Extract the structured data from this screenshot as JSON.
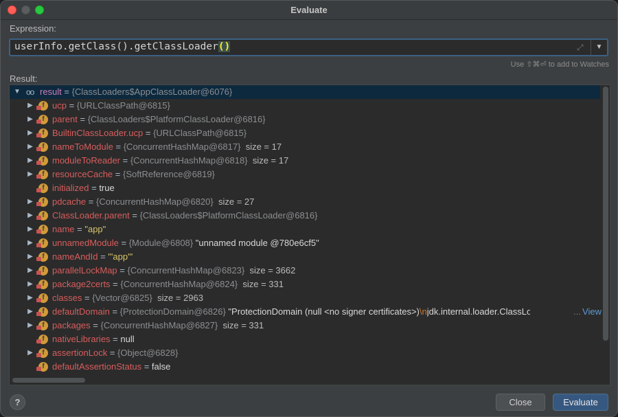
{
  "window": {
    "title": "Evaluate"
  },
  "expression": {
    "label": "Expression:",
    "text": "userInfo.getClass().getClassLoader",
    "paren": "()",
    "hint": "Use ⇧⌘⏎ to add to Watches"
  },
  "result": {
    "label": "Result:",
    "root": {
      "name": "result",
      "eq": " = ",
      "ref": "{ClassLoaders$AppClassLoader@6076}"
    },
    "rows": [
      {
        "name": "ucp",
        "ref": "{URLClassPath@6815}",
        "extra": "",
        "expandable": true
      },
      {
        "name": "parent",
        "ref": "{ClassLoaders$PlatformClassLoader@6816}",
        "extra": "",
        "expandable": true
      },
      {
        "name": "BuiltinClassLoader.ucp",
        "ref": "{URLClassPath@6815}",
        "extra": "",
        "expandable": true
      },
      {
        "name": "nameToModule",
        "ref": "{ConcurrentHashMap@6817}",
        "extra": "size = 17",
        "expandable": true
      },
      {
        "name": "moduleToReader",
        "ref": "{ConcurrentHashMap@6818}",
        "extra": "size = 17",
        "expandable": true
      },
      {
        "name": "resourceCache",
        "ref": "{SoftReference@6819}",
        "extra": "",
        "expandable": true
      },
      {
        "name": "initialized",
        "ref": "",
        "value": "true",
        "extra": "",
        "expandable": false
      },
      {
        "name": "pdcache",
        "ref": "{ConcurrentHashMap@6820}",
        "extra": "size = 27",
        "expandable": true
      },
      {
        "name": "ClassLoader.parent",
        "ref": "{ClassLoaders$PlatformClassLoader@6816}",
        "extra": "",
        "expandable": true
      },
      {
        "name": "name",
        "ref": "",
        "str": "\"app\"",
        "extra": "",
        "expandable": true
      },
      {
        "name": "unnamedModule",
        "ref": "{Module@6808}",
        "plain": "\"unnamed module @780e6cf5\"",
        "extra": "",
        "expandable": true
      },
      {
        "name": "nameAndId",
        "ref": "",
        "str": "\"'app'\"",
        "extra": "",
        "expandable": true
      },
      {
        "name": "parallelLockMap",
        "ref": "{ConcurrentHashMap@6823}",
        "extra": "size = 3662",
        "expandable": true
      },
      {
        "name": "package2certs",
        "ref": "{ConcurrentHashMap@6824}",
        "extra": "size = 331",
        "expandable": true
      },
      {
        "name": "classes",
        "ref": "{Vector@6825}",
        "extra": "size = 2963",
        "expandable": true
      },
      {
        "name": "defaultDomain",
        "ref": "{ProtectionDomain@6826}",
        "plain": "\"ProtectionDomain  (null <no signer certificates>)",
        "escape": "\\n",
        "tail": " jdk.internal.loader.ClassLo",
        "ellipsis": "...",
        "view": "View",
        "extra": "",
        "expandable": true
      },
      {
        "name": "packages",
        "ref": "{ConcurrentHashMap@6827}",
        "extra": "size = 331",
        "expandable": true
      },
      {
        "name": "nativeLibraries",
        "ref": "",
        "value": "null",
        "extra": "",
        "expandable": false
      },
      {
        "name": "assertionLock",
        "ref": "{Object@6828}",
        "extra": "",
        "expandable": true
      },
      {
        "name": "defaultAssertionStatus",
        "ref": "",
        "value": "false",
        "extra": "",
        "expandable": false
      }
    ]
  },
  "buttons": {
    "help": "?",
    "close": "Close",
    "evaluate": "Evaluate"
  },
  "colors": {
    "accent": "#365880",
    "field_name": "#d85d5d",
    "string": "#d6c56b",
    "reference": "#8b8e91"
  }
}
